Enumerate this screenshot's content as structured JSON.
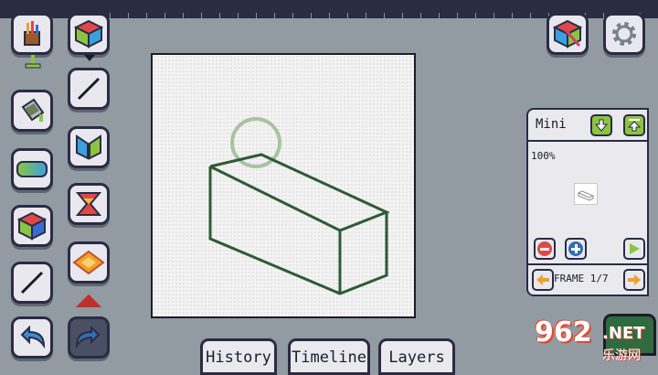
{
  "tabs": [
    {
      "label": "History"
    },
    {
      "label": "Timeline"
    },
    {
      "label": "Layers"
    }
  ],
  "mini_panel": {
    "title": "Mini",
    "zoom": "100%",
    "frame_label": "FRAME 1/7"
  },
  "watermark": {
    "number": "962",
    "suffix": ".NET",
    "sub": "乐游网"
  },
  "colors": {
    "drawing_stroke": "#2f5a35",
    "brush_cursor": "#a9c2a4",
    "accent_orange": "#f0a02a",
    "accent_green": "#8bc53f",
    "accent_red": "#e04848",
    "accent_blue": "#3a6ad4",
    "panel_border": "#2a2c44"
  },
  "icons": {
    "palette": "paint-brushes-icon",
    "shape3d": "cube-icon",
    "line": "line-icon",
    "fill": "paint-bucket-icon",
    "mirror": "mirror-icon",
    "gradient": "gradient-icon",
    "flip": "flip-icon",
    "cube": "cube-icon",
    "diamond": "diamond-icon",
    "undo": "undo-icon",
    "redo": "redo-icon",
    "export": "export-cube-icon",
    "settings": "gear-icon"
  }
}
